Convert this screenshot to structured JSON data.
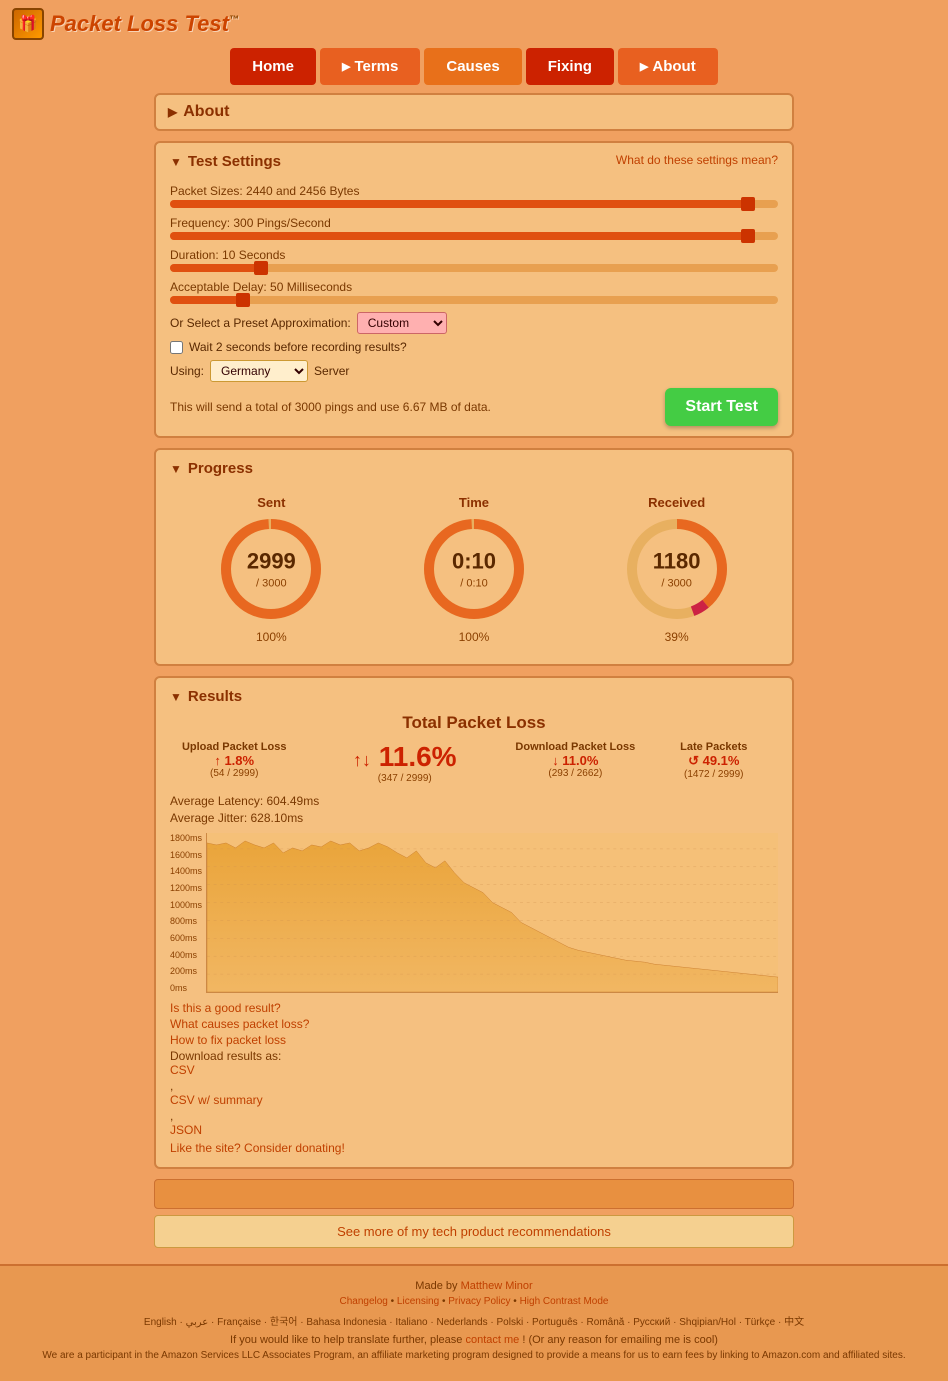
{
  "site": {
    "title": "Packet Loss Test",
    "tm": "™"
  },
  "nav": {
    "home": "Home",
    "terms": "Terms",
    "causes": "Causes",
    "fixing": "Fixing",
    "about": "About"
  },
  "about_panel": {
    "title": "About"
  },
  "test_settings": {
    "title": "Test Settings",
    "settings_link": "What do these settings mean?",
    "packet_sizes_label": "Packet Sizes: 2440 and 2456 Bytes",
    "frequency_label": "Frequency: 300 Pings/Second",
    "duration_label": "Duration: 10 Seconds",
    "delay_label": "Acceptable Delay: 50 Milliseconds",
    "preset_label": "Or Select a Preset Approximation:",
    "preset_value": "Custom",
    "wait_label": "Wait 2 seconds before recording results?",
    "using_label": "Using:",
    "server_value": "Germany",
    "server_suffix": "Server",
    "info_text": "This will send a total of 3000 pings and use 6.67 MB of data.",
    "start_btn": "Start Test",
    "sliders": {
      "packet_size_pct": 95,
      "frequency_pct": 95,
      "duration_pct": 15,
      "delay_pct": 12
    }
  },
  "progress": {
    "title": "Progress",
    "sent_label": "Sent",
    "time_label": "Time",
    "received_label": "Received",
    "sent_value": "2999",
    "sent_total": "/ 3000",
    "sent_pct": "100%",
    "time_value": "0:10",
    "time_total": "/ 0:10",
    "time_pct": "100%",
    "received_value": "1180",
    "received_total": "/ 3000",
    "received_pct": "39%"
  },
  "results": {
    "title": "Results",
    "total_loss_label": "Total Packet Loss",
    "total_loss_value": "11.6%",
    "total_loss_fraction": "(347 / 2999)",
    "upload_loss_label": "Upload Packet Loss",
    "upload_loss_value": "↑ 1.8%",
    "upload_loss_fraction": "(54 / 2999)",
    "download_loss_label": "Download Packet Loss",
    "download_loss_value": "↓ 11.0%",
    "download_loss_fraction": "(293 / 2662)",
    "late_label": "Late Packets",
    "late_value": "↺ 49.1%",
    "late_fraction": "(1472 / 2999)",
    "avg_latency": "Average Latency: 604.49ms",
    "avg_jitter": "Average Jitter: 628.10ms",
    "chart_y_labels": [
      "1800ms",
      "1600ms",
      "1400ms",
      "1200ms",
      "1000ms",
      "800ms",
      "600ms",
      "400ms",
      "200ms",
      "0ms"
    ],
    "links": {
      "good_result": "Is this a good result?",
      "causes": "What causes packet loss?",
      "fix": "How to fix packet loss",
      "download_label": "Download results as:",
      "csv": "CSV",
      "csv_summary": "CSV w/ summary",
      "json": "JSON",
      "donate": "Like the site? Consider donating!"
    }
  },
  "footer": {
    "recs_link": "See more of my tech product recommendations",
    "made_by": "Made by",
    "author": "Matthew Minor",
    "author_url": "#",
    "changelog": "Changelog",
    "licensing": "Licensing",
    "privacy": "Privacy Policy",
    "high_contrast": "High Contrast Mode",
    "languages": "English · عربي · Française · 한국어 · Bahasa Indonesia · Italiano · Nederlands · Polski · Português · Română · Русский · Shqipian/Hol · Türkçe · 中文",
    "translate_text": "If you would like to help translate further, please",
    "translate_link": "contact me",
    "translate_suffix": "! (Or any reason for emailing me is cool)",
    "amazon_text": "We are a participant in the Amazon Services LLC Associates Program, an affiliate marketing program designed to provide a means for us to earn fees by linking to Amazon.com and affiliated sites."
  }
}
